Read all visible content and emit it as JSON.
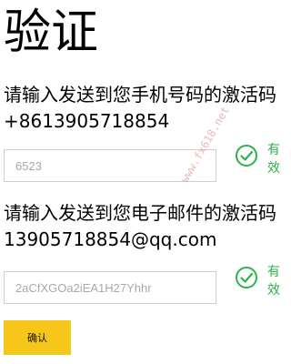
{
  "title": "验证",
  "phone_section": {
    "prompt": "请输入发送到您手机号码的激活码 +8613905718854",
    "placeholder": "6523",
    "status_text": "有效"
  },
  "email_section": {
    "prompt": "请输入发送到您电子邮件的激活码 13905718854@qq.com",
    "placeholder": "2aCfXGOa2iEA1H27Yhhr",
    "status_text": "有效"
  },
  "confirm_label": "确认",
  "watermark": "www.fx618.net",
  "colors": {
    "accent": "#f7c61a",
    "valid": "#2bb24c",
    "field_border": "#cfcfcf"
  }
}
